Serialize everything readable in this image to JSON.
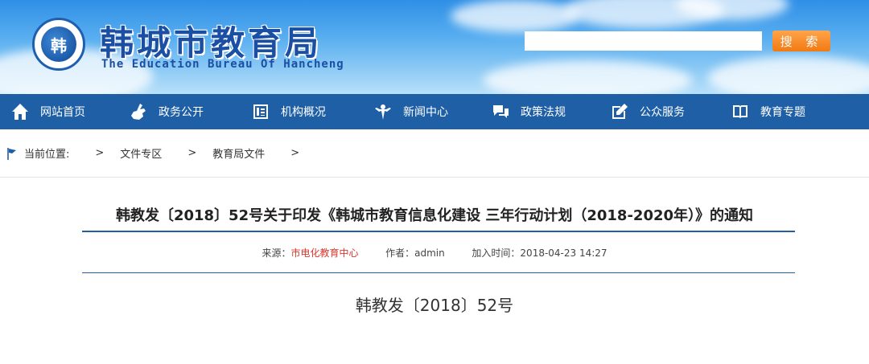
{
  "header": {
    "title": "韩城市教育局",
    "subtitle": "The Education Bureau Of Hancheng",
    "logo_char": "韩",
    "search_placeholder": "",
    "search_label": "搜 索"
  },
  "nav": {
    "items": [
      {
        "label": "网站首页",
        "icon": "home-icon"
      },
      {
        "label": "政务公开",
        "icon": "hand-icon"
      },
      {
        "label": "机构概况",
        "icon": "document-icon"
      },
      {
        "label": "新闻中心",
        "icon": "people-icon"
      },
      {
        "label": "政策法规",
        "icon": "chat-icon"
      },
      {
        "label": "公众服务",
        "icon": "edit-icon"
      },
      {
        "label": "教育专题",
        "icon": "book-icon"
      }
    ]
  },
  "breadcrumb": {
    "label": "当前位置:",
    "sep": ">",
    "items": [
      "文件专区",
      "教育局文件"
    ]
  },
  "article": {
    "title": "韩教发〔2018〕52号关于印发《韩城市教育信息化建设 三年行动计划（2018-2020年）》的通知",
    "source_label": "来源：",
    "source_value": "市电化教育中心",
    "author_label": "作者：",
    "author_value": "admin",
    "time_label": "加入时间：",
    "time_value": "2018-04-23 14:27",
    "doc_number": "韩教发〔2018〕52号"
  },
  "colors": {
    "nav_bg": "#1f5fa6",
    "title_blue": "#1a4fa3",
    "search_orange": "#f17a12",
    "source_red": "#e0372c"
  }
}
